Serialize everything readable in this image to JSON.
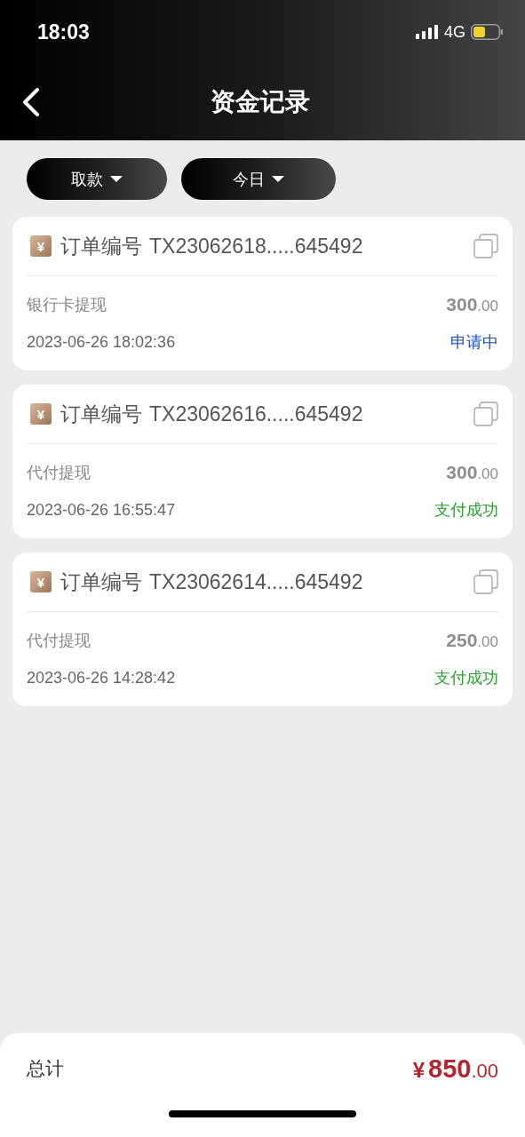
{
  "status_bar": {
    "time": "18:03",
    "network": "4G"
  },
  "header": {
    "title": "资金记录"
  },
  "filters": [
    {
      "label": "取款"
    },
    {
      "label": "今日"
    }
  ],
  "records": [
    {
      "badge": "¥",
      "order_label": "订单编号",
      "order_no": "TX23062618.....645492",
      "type": "银行卡提现",
      "amount": "300",
      "decimals": ".00",
      "time": "2023-06-26 18:02:36",
      "status": "申请中",
      "kind": "pending"
    },
    {
      "badge": "¥",
      "order_label": "订单编号",
      "order_no": "TX23062616.....645492",
      "type": "代付提现",
      "amount": "300",
      "decimals": ".00",
      "time": "2023-06-26 16:55:47",
      "status": "支付成功",
      "kind": "success"
    },
    {
      "badge": "¥",
      "order_label": "订单编号",
      "order_no": "TX23062614.....645492",
      "type": "代付提现",
      "amount": "250",
      "decimals": ".00",
      "time": "2023-06-26 14:28:42",
      "status": "支付成功",
      "kind": "success"
    }
  ],
  "footer": {
    "label": "总计",
    "currency": "¥",
    "amount": "850",
    "decimals": ".00"
  }
}
